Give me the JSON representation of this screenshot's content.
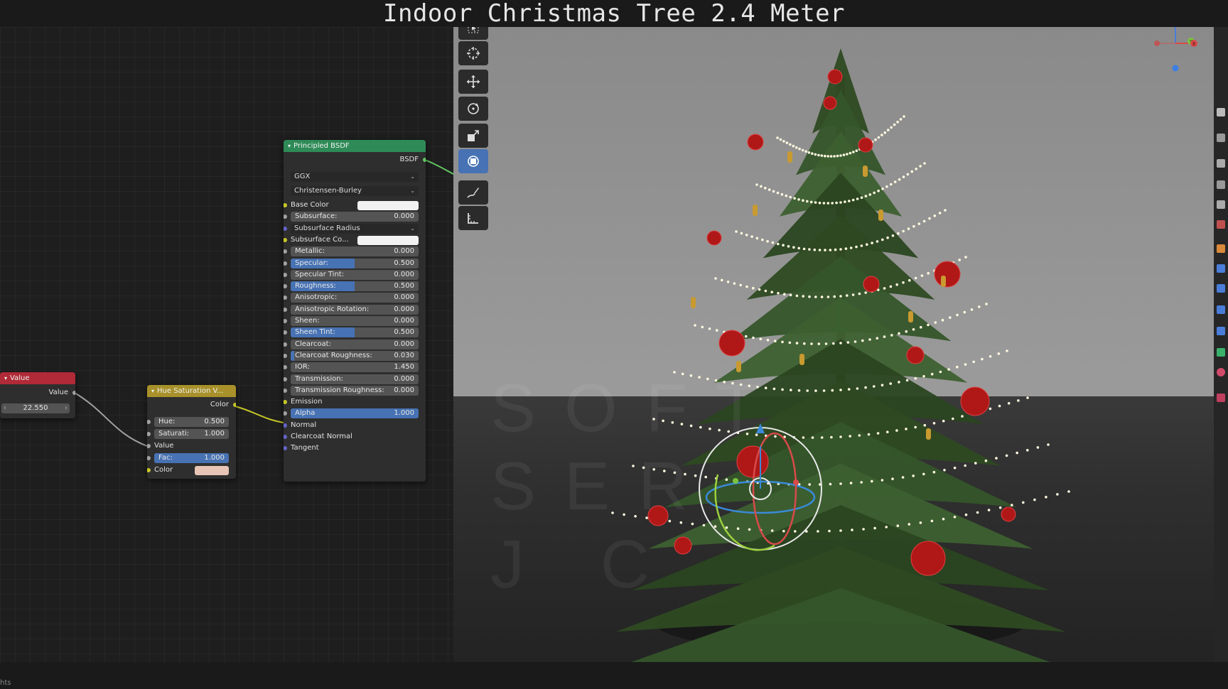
{
  "window": {
    "title": "Indoor Christmas Tree 2.4 Meter"
  },
  "status": {
    "text": "hts"
  },
  "watermark": {
    "lines": [
      "SOFT",
      "SER",
      "J C"
    ]
  },
  "colors": {
    "header_value": "#b02a37",
    "header_converter": "#a8912a",
    "header_shader": "#2e8b57",
    "field_active": "#4772b3",
    "socket_gray": "#a1a1a1",
    "socket_yellow": "#c7c729",
    "socket_green": "#63c763",
    "socket_purple": "#6363c7"
  },
  "nodes": {
    "value": {
      "title": "Value",
      "output_label": "Value",
      "value": "22.550"
    },
    "hue_saturation": {
      "title": "Hue Saturation V...",
      "output_label": "Color",
      "hue_label": "Hue:",
      "hue_value": "0.500",
      "saturation_label": "Saturati:",
      "saturation_value": "1.000",
      "value_label": "Value",
      "fac_label": "Fac:",
      "fac_value": "1.000",
      "color_label": "Color"
    },
    "principled_bsdf": {
      "title": "Principled BSDF",
      "output_label": "BSDF",
      "distribution": "GGX",
      "subsurface_method": "Christensen-Burley",
      "inputs": [
        {
          "label": "Base Color",
          "kind": "color",
          "socket": "yellow"
        },
        {
          "label": "Subsurface:",
          "value": "0.000",
          "socket": "gray"
        },
        {
          "label": "Subsurface Radius",
          "kind": "dropdown",
          "socket": "purple"
        },
        {
          "label": "Subsurface Co...",
          "kind": "color",
          "socket": "yellow"
        },
        {
          "label": "Metallic:",
          "value": "0.000",
          "socket": "gray"
        },
        {
          "label": "Specular:",
          "value": "0.500",
          "fill": 0.5,
          "socket": "gray"
        },
        {
          "label": "Specular Tint:",
          "value": "0.000",
          "socket": "gray"
        },
        {
          "label": "Roughness:",
          "value": "0.500",
          "fill": 0.5,
          "socket": "gray"
        },
        {
          "label": "Anisotropic:",
          "value": "0.000",
          "socket": "gray"
        },
        {
          "label": "Anisotropic Rotation:",
          "value": "0.000",
          "socket": "gray"
        },
        {
          "label": "Sheen:",
          "value": "0.000",
          "socket": "gray"
        },
        {
          "label": "Sheen Tint:",
          "value": "0.500",
          "fill": 0.5,
          "socket": "gray"
        },
        {
          "label": "Clearcoat:",
          "value": "0.000",
          "socket": "gray"
        },
        {
          "label": "Clearcoat Roughness:",
          "value": "0.030",
          "fill": 0.03,
          "socket": "gray"
        },
        {
          "label": "IOR:",
          "value": "1.450",
          "socket": "gray"
        },
        {
          "label": "Transmission:",
          "value": "0.000",
          "socket": "gray"
        },
        {
          "label": "Transmission Roughness:",
          "value": "0.000",
          "socket": "gray"
        },
        {
          "label": "Emission",
          "kind": "socket",
          "socket": "yellow"
        },
        {
          "label": "Alpha",
          "value": "1.000",
          "fill": 1.0,
          "socket": "gray"
        },
        {
          "label": "Normal",
          "kind": "socket",
          "socket": "purple"
        },
        {
          "label": "Clearcoat Normal",
          "kind": "socket",
          "socket": "purple"
        },
        {
          "label": "Tangent",
          "kind": "socket",
          "socket": "purple"
        }
      ]
    }
  },
  "viewport": {
    "tools": [
      "select-box-icon",
      "cursor-icon",
      "move-icon",
      "rotate-icon",
      "scale-icon",
      "transform-icon",
      "annotate-icon",
      "measure-icon"
    ],
    "active_tool": "transform-icon",
    "gizmo_axes": [
      "Z",
      "Y",
      "X"
    ]
  }
}
